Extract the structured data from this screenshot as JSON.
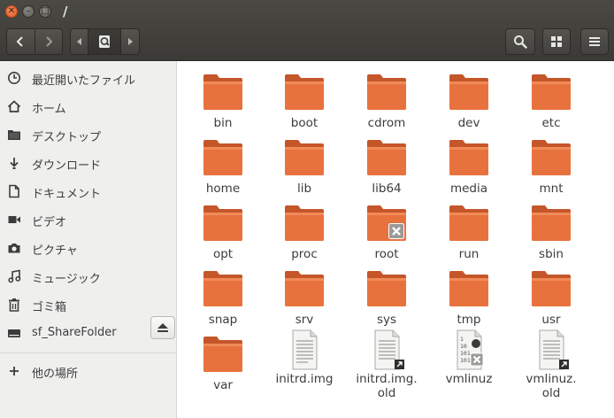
{
  "window": {
    "title": "/"
  },
  "toolbar": {
    "back": "chevron-left-icon",
    "forward": "chevron-right-icon",
    "path_prev": "caret-left-icon",
    "path_next": "caret-right-icon",
    "root_location": "root-disk-icon",
    "search": "search-icon",
    "view": "grid-view-icon",
    "menu": "hamburger-menu-icon"
  },
  "sidebar": {
    "items": [
      {
        "label": "最近開いたファイル",
        "icon": "clock-icon"
      },
      {
        "label": "ホーム",
        "icon": "home-icon"
      },
      {
        "label": "デスクトップ",
        "icon": "folder-icon"
      },
      {
        "label": "ダウンロード",
        "icon": "download-icon"
      },
      {
        "label": "ドキュメント",
        "icon": "document-icon"
      },
      {
        "label": "ビデオ",
        "icon": "video-icon"
      },
      {
        "label": "ピクチャ",
        "icon": "camera-icon"
      },
      {
        "label": "ミュージック",
        "icon": "music-icon"
      },
      {
        "label": "ゴミ箱",
        "icon": "trash-icon"
      },
      {
        "label": "sf_ShareFolder",
        "icon": "drive-icon"
      },
      {
        "label": "他の場所",
        "icon": "plus-icon"
      }
    ]
  },
  "files": {
    "row1": [
      "bin",
      "boot",
      "cdrom",
      "dev",
      "etc"
    ],
    "row2": [
      "home",
      "lib",
      "lib64",
      "media",
      "mnt"
    ],
    "row3": [
      "opt",
      "proc",
      "root",
      "run",
      "sbin"
    ],
    "row4": [
      "snap",
      "srv",
      "sys",
      "tmp",
      "usr"
    ],
    "row5": [
      "var",
      "initrd.img",
      "initrd.img.\nold",
      "vmlinuz",
      "vmlinuz.\nold"
    ]
  },
  "colors": {
    "accent": "#e05d2b",
    "folder": "#e86f3a",
    "header": "#3f3e3a"
  }
}
